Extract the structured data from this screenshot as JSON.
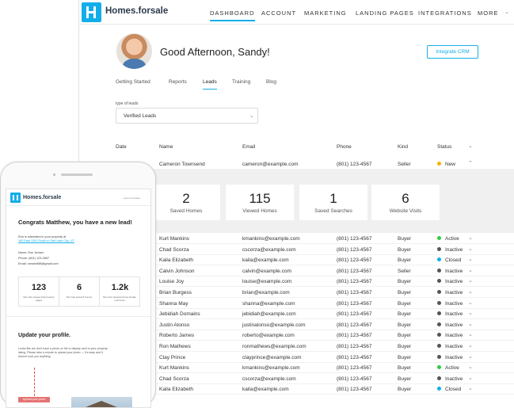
{
  "brand": {
    "name": "Homes.forsale"
  },
  "nav": {
    "items": [
      "DASHBOARD",
      "ACCOUNT",
      "MARKETING",
      "LANDING PAGES",
      "INTEGRATIONS",
      "MORE"
    ],
    "active": "DASHBOARD"
  },
  "header": {
    "greeting": "Good Afternoon, Sandy!",
    "integrate_button": "Integrate CRM"
  },
  "tabs": {
    "items": [
      "Getting Started",
      "Reports",
      "Leads",
      "Training",
      "Blog"
    ],
    "active": "Leads"
  },
  "filter": {
    "label": "type of leads",
    "value": "Verified Leads"
  },
  "table": {
    "columns": [
      "Date",
      "Name",
      "Email",
      "Phone",
      "Kind",
      "Status"
    ],
    "first_row": {
      "name": "Cameron Townsend",
      "email": "cameron@example.com",
      "phone": "(801) 123-4567",
      "kind": "Seller",
      "status": "New",
      "status_color": "#f5b400"
    },
    "rows": [
      {
        "name": "Kurt Mankins",
        "email": "kmankins@example.com",
        "phone": "(801) 123-4567",
        "kind": "Buyer",
        "status": "Active",
        "status_color": "#2ecc40"
      },
      {
        "name": "Chad Scorza",
        "email": "cscorza@example.com",
        "phone": "(801) 123-4567",
        "kind": "Buyer",
        "status": "Inactive",
        "status_color": "#555555"
      },
      {
        "name": "Kaila Elizabeth",
        "email": "kaila@example.com",
        "phone": "(801) 123-4567",
        "kind": "Buyer",
        "status": "Closed",
        "status_color": "#13aeea"
      },
      {
        "name": "Calvin Johnson",
        "email": "calvin@example.com",
        "phone": "(801) 123-4567",
        "kind": "Seller",
        "status": "Inactive",
        "status_color": "#555555"
      },
      {
        "name": "Louise Joy",
        "email": "louise@example.com",
        "phone": "(801) 123-4567",
        "kind": "Buyer",
        "status": "Inactive",
        "status_color": "#555555"
      },
      {
        "name": "Brian Burgess",
        "email": "brian@example.com",
        "phone": "(801) 123-4567",
        "kind": "Buyer",
        "status": "Inactive",
        "status_color": "#555555"
      },
      {
        "name": "Shanna May",
        "email": "shanna@example.com",
        "phone": "(801) 123-4567",
        "kind": "Buyer",
        "status": "Inactive",
        "status_color": "#555555"
      },
      {
        "name": "Jebidiah Domains",
        "email": "jebidiah@example.com",
        "phone": "(801) 123-4567",
        "kind": "Buyer",
        "status": "Inactive",
        "status_color": "#555555"
      },
      {
        "name": "Justin Alonso",
        "email": "justinalonso@example.com",
        "phone": "(801) 123-4567",
        "kind": "Buyer",
        "status": "Inactive",
        "status_color": "#555555"
      },
      {
        "name": "Roberto James",
        "email": "roberto@example.com",
        "phone": "(801) 123-4567",
        "kind": "Buyer",
        "status": "Inactive",
        "status_color": "#555555"
      },
      {
        "name": "Ron Mathews",
        "email": "ronmathews@example.com",
        "phone": "(801) 123-4567",
        "kind": "Buyer",
        "status": "Inactive",
        "status_color": "#555555"
      },
      {
        "name": "Clay Prince",
        "email": "clayprince@example.com",
        "phone": "(801) 123-4567",
        "kind": "Buyer",
        "status": "Inactive",
        "status_color": "#555555"
      },
      {
        "name": "Kurt Mankins",
        "email": "kmankins@example.com",
        "phone": "(801) 123-4567",
        "kind": "Buyer",
        "status": "Active",
        "status_color": "#2ecc40"
      },
      {
        "name": "Chad Scorza",
        "email": "cscorza@example.com",
        "phone": "(801) 123-4567",
        "kind": "Buyer",
        "status": "Inactive",
        "status_color": "#555555"
      },
      {
        "name": "Kaila Elizabeth",
        "email": "kaila@example.com",
        "phone": "(801) 123-4567",
        "kind": "Buyer",
        "status": "Closed",
        "status_color": "#13aeea"
      }
    ]
  },
  "expanded": {
    "stats": [
      {
        "value": "2",
        "label": "Saved Homes"
      },
      {
        "value": "115",
        "label": "Viewed Homes"
      },
      {
        "value": "1",
        "label": "Saved Searches"
      },
      {
        "value": "6",
        "label": "Website Visits"
      }
    ]
  },
  "mobile": {
    "brand": "Homes.forsale",
    "header_link": "open in browser",
    "title": "Congrats Matthew, you have a new lead!",
    "interest": "Ron is interested in your property at",
    "address": "160 East 1300 South in Salt Lake City, UT",
    "name_line": "Name: Ron Jensen",
    "phone_line": "Phone: (801) 123-4567",
    "email_line": "Email: ronsen888@gmail.com",
    "stats": [
      {
        "value": "123",
        "label": "Ron has viewed 123 property pages"
      },
      {
        "value": "6",
        "label": "Ron has saved 6 homes"
      },
      {
        "value": "1.2k",
        "label": "Ron has viewed Homes.forsale 1.2k times"
      }
    ],
    "section_title": "Update your profile.",
    "section_text": "Looks like we don't have a photo on file to display next to your property listing. Please take a minute to upload your photo — it's easy and it doesn't cost you anything.",
    "upload_button": "Upload your photo"
  },
  "colors": {
    "accent": "#13aeea"
  }
}
